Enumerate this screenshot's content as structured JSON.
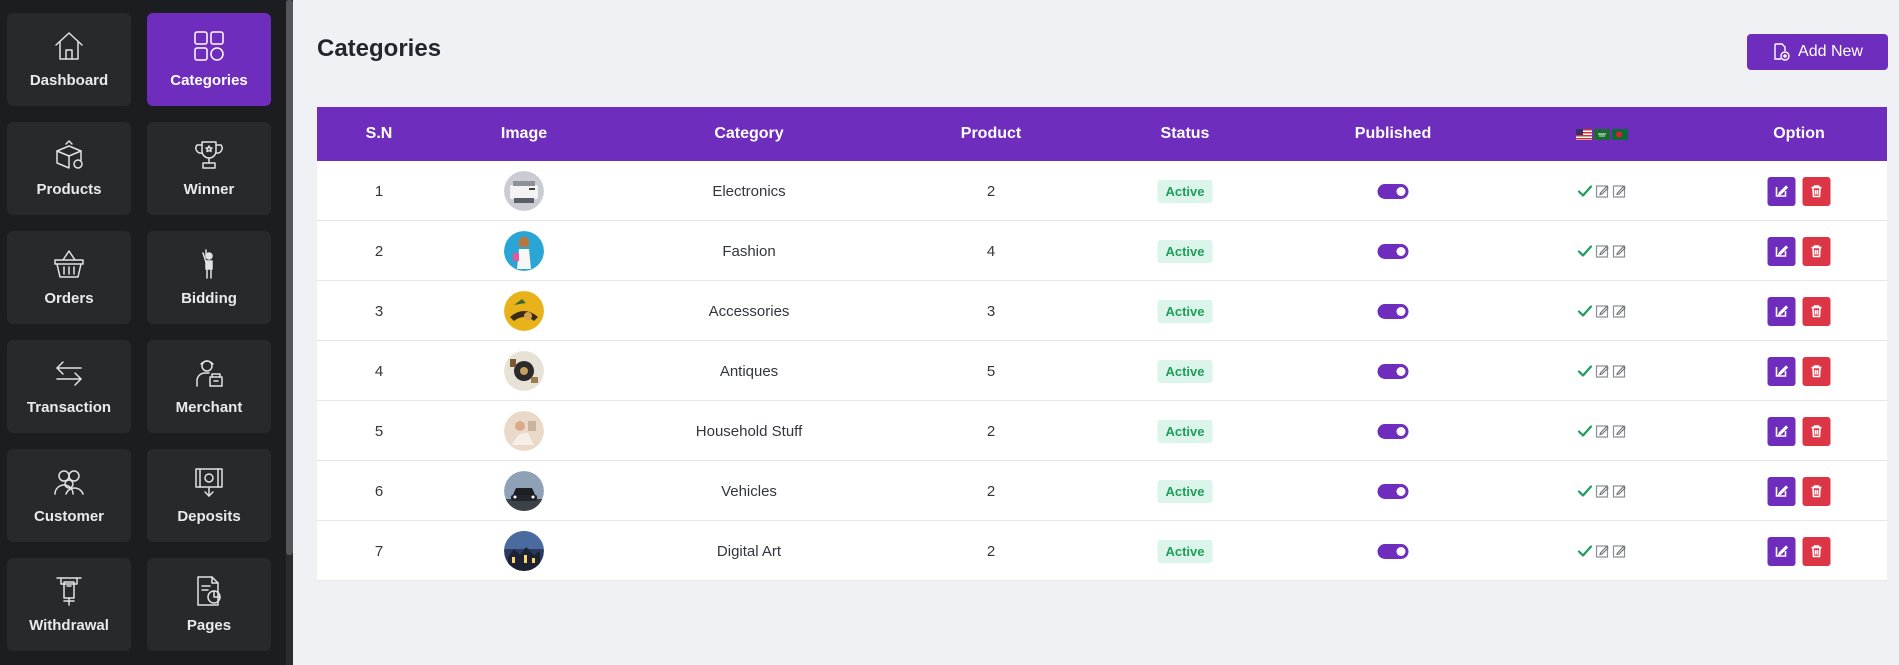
{
  "sidebar": {
    "items": [
      {
        "label": "Dashboard",
        "icon": "home-icon",
        "active": false
      },
      {
        "label": "Categories",
        "icon": "grid-icon",
        "active": true
      },
      {
        "label": "Products",
        "icon": "box-icon",
        "active": false
      },
      {
        "label": "Winner",
        "icon": "trophy-icon",
        "active": false
      },
      {
        "label": "Orders",
        "icon": "basket-icon",
        "active": false
      },
      {
        "label": "Bidding",
        "icon": "person-raise-hand-icon",
        "active": false
      },
      {
        "label": "Transaction",
        "icon": "arrows-exchange-icon",
        "active": false
      },
      {
        "label": "Merchant",
        "icon": "merchant-icon",
        "active": false
      },
      {
        "label": "Customer",
        "icon": "users-icon",
        "active": false
      },
      {
        "label": "Deposits",
        "icon": "deposit-icon",
        "active": false
      },
      {
        "label": "Withdrawal",
        "icon": "atm-withdraw-icon",
        "active": false
      },
      {
        "label": "Pages",
        "icon": "document-chart-icon",
        "active": false
      }
    ]
  },
  "header": {
    "title": "Categories",
    "add_new_label": "Add New"
  },
  "table": {
    "columns": {
      "sn": "S.N",
      "image": "Image",
      "category": "Category",
      "product": "Product",
      "status": "Status",
      "published": "Published",
      "languages": "flags-us-sa-bd",
      "option": "Option"
    },
    "rows": [
      {
        "sn": "1",
        "category": "Electronics",
        "product": "2",
        "status": "Active",
        "published": true,
        "thumb": "printer"
      },
      {
        "sn": "2",
        "category": "Fashion",
        "product": "4",
        "status": "Active",
        "published": true,
        "thumb": "fashion"
      },
      {
        "sn": "3",
        "category": "Accessories",
        "product": "3",
        "status": "Active",
        "published": true,
        "thumb": "accessories"
      },
      {
        "sn": "4",
        "category": "Antiques",
        "product": "5",
        "status": "Active",
        "published": true,
        "thumb": "antiques"
      },
      {
        "sn": "5",
        "category": "Household Stuff",
        "product": "2",
        "status": "Active",
        "published": true,
        "thumb": "household"
      },
      {
        "sn": "6",
        "category": "Vehicles",
        "product": "2",
        "status": "Active",
        "published": true,
        "thumb": "vehicles"
      },
      {
        "sn": "7",
        "category": "Digital Art",
        "product": "2",
        "status": "Active",
        "published": true,
        "thumb": "digital-art"
      }
    ]
  },
  "colors": {
    "accent": "#6f2dbd",
    "danger": "#dc3545",
    "success": "#1f9d5a",
    "sidebar_bg": "#1c1d20",
    "tile_bg": "#28292c"
  }
}
